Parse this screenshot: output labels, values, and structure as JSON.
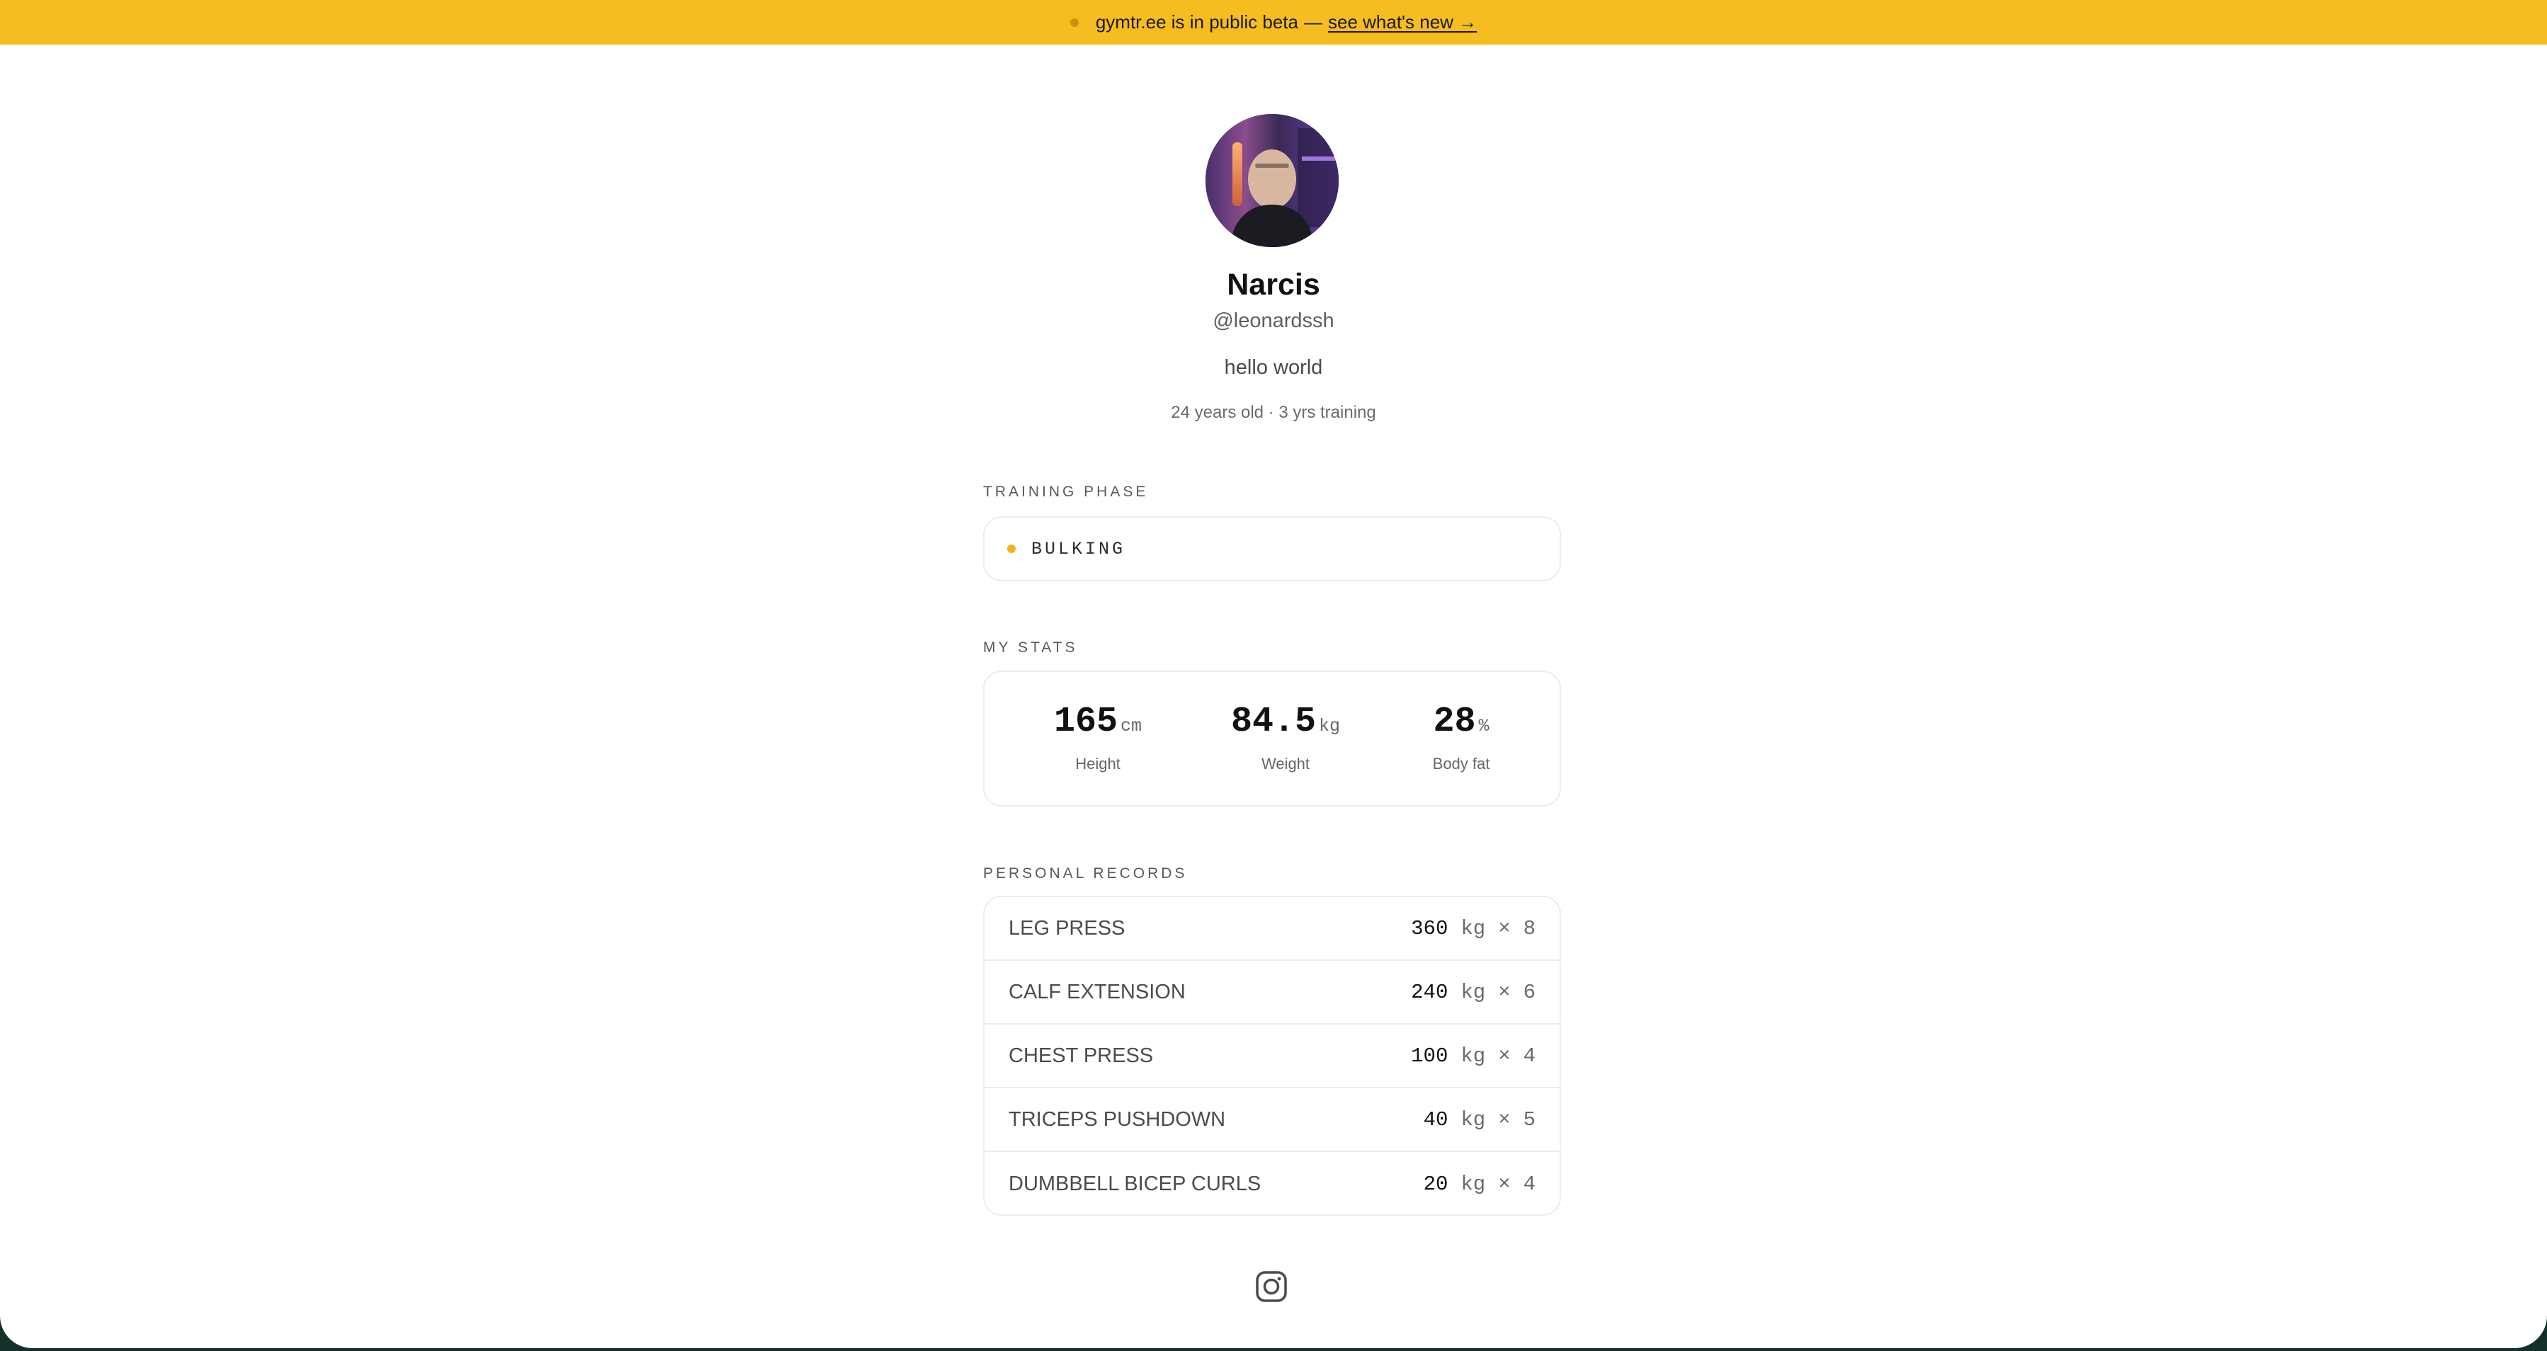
{
  "banner": {
    "text": "gymtr.ee is in public beta",
    "separator": "—",
    "link": "see what's new →"
  },
  "profile": {
    "name": "Narcis",
    "handle": "@leonardssh",
    "bio": "hello world",
    "meta": "24 years old · 3 yrs training"
  },
  "training_phase": {
    "label": "TRAINING PHASE",
    "value": "BULKING",
    "dot_color": "#f2b21a"
  },
  "stats": {
    "label": "MY STATS",
    "items": [
      {
        "value": "165",
        "unit": "cm",
        "label": "Height"
      },
      {
        "value": "84.5",
        "unit": "kg",
        "label": "Weight"
      },
      {
        "value": "28",
        "unit": "%",
        "label": "Body fat"
      }
    ]
  },
  "records": {
    "label": "PERSONAL RECORDS",
    "rows": [
      {
        "name": "LEG PRESS",
        "weight": "360",
        "unit": "kg",
        "times": "×",
        "reps": "8"
      },
      {
        "name": "CALF EXTENSION",
        "weight": "240",
        "unit": "kg",
        "times": "×",
        "reps": "6"
      },
      {
        "name": "CHEST PRESS",
        "weight": "100",
        "unit": "kg",
        "times": "×",
        "reps": "4"
      },
      {
        "name": "TRICEPS PUSHDOWN",
        "weight": "40",
        "unit": "kg",
        "times": "×",
        "reps": "5"
      },
      {
        "name": "DUMBBELL BICEP CURLS",
        "weight": "20",
        "unit": "kg",
        "times": "×",
        "reps": "4"
      }
    ]
  },
  "social": {
    "icon": "instagram-icon"
  },
  "colors": {
    "banner": "#f5bd1f",
    "accent": "#f2b21a"
  }
}
